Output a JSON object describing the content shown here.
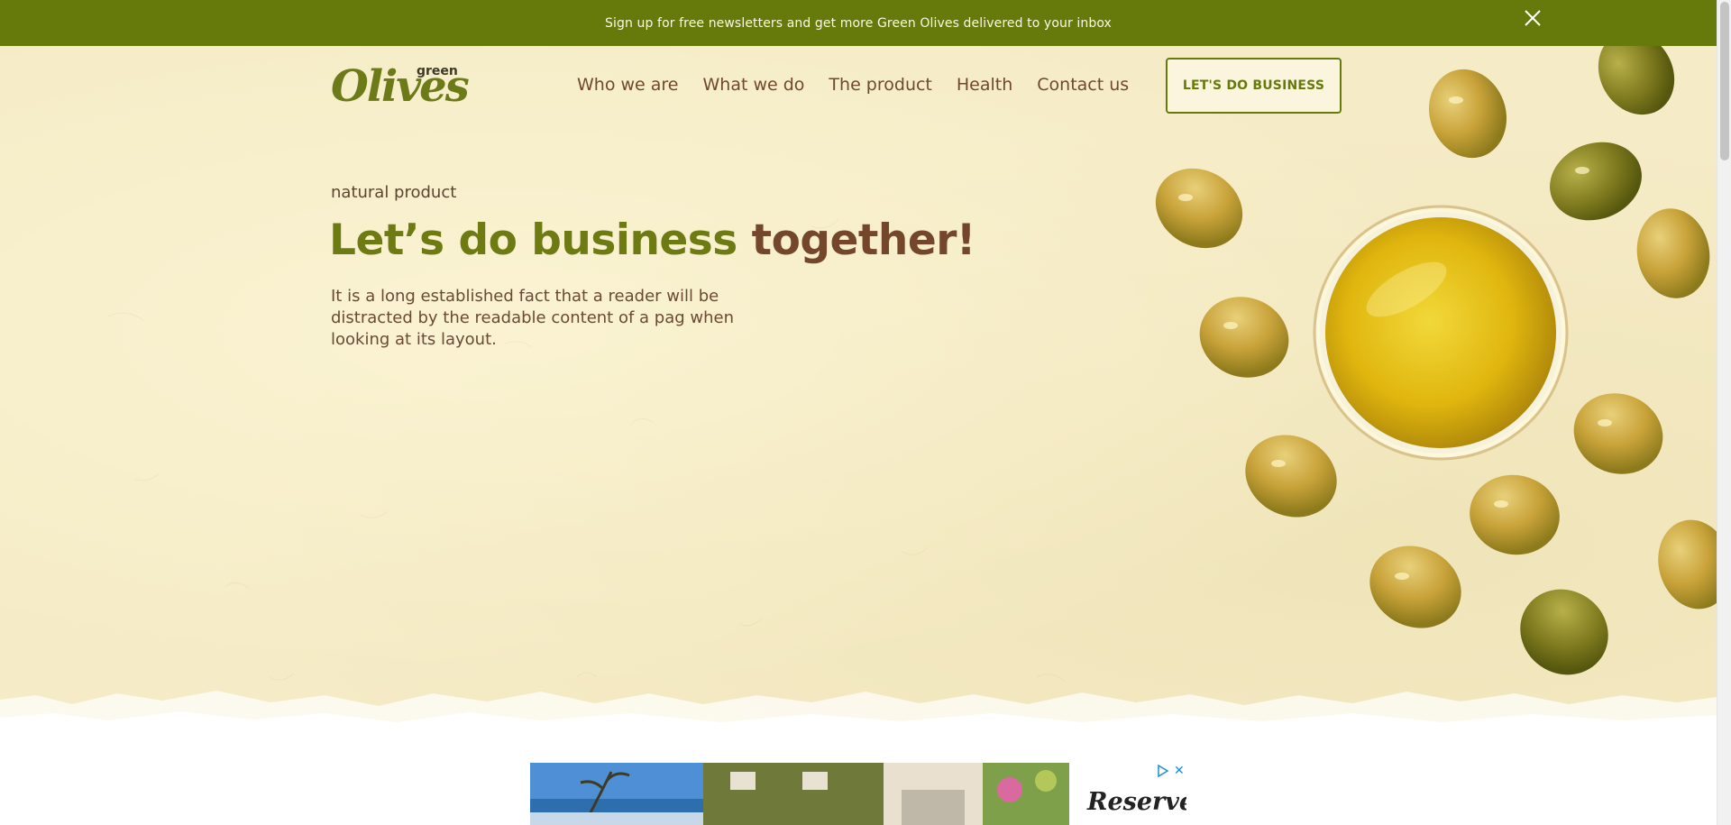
{
  "banner": {
    "text": "Sign up for free newsletters and get more Green Olives delivered to your inbox",
    "close_icon": "close-icon"
  },
  "header": {
    "logo_main": "Olives",
    "logo_small": "green",
    "nav": [
      "Who we are",
      "What we do",
      "The product",
      "Health",
      "Contact us"
    ],
    "cta_label": "LET'S DO BUSINESS"
  },
  "hero": {
    "eyebrow": "natural product",
    "headline_part1": "Let’s do business ",
    "headline_part2": "together!",
    "lead": "It is a long established fact that a reader will be distracted by the readable content of a pag when looking at its layout."
  },
  "ad": {
    "reserve_label": "Reserve",
    "choices_icon": "ad-choices-icon",
    "close_label": "✕"
  },
  "colors": {
    "banner_bg": "#667a0c",
    "hero_bg": "#f5ebc6",
    "brand_green": "#6e7a12",
    "brand_brown": "#74462c"
  }
}
